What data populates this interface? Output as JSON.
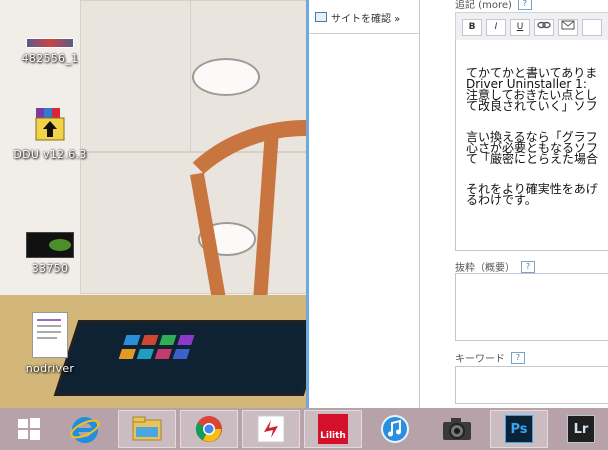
{
  "desktop": {
    "icons": [
      {
        "label": "482556_1",
        "icon": "image-thumbnail-icon"
      },
      {
        "label": "DDU v12.6.3",
        "icon": "winrar-archive-icon"
      },
      {
        "label": "33750",
        "icon": "gpu-image-icon"
      },
      {
        "label": "nodriver",
        "icon": "text-document-icon"
      }
    ]
  },
  "browser": {
    "sidebar_link": "サイトを確認 »",
    "main_header": "追記 (more)",
    "help_mark": "?",
    "editor_toolbar": [
      "B",
      "I",
      "U",
      "link",
      "mail",
      "more"
    ],
    "editor_lines": [
      "てかてかと書いてありま",
      "Driver Uninstaller 1:",
      "注意しておきたい点とし",
      "て改良されていく」ソフ"
    ],
    "editor_lines_2": [
      "言い換えるなら「グラフ",
      "心さが必要ともなるソフ",
      "て「厳密にとらえた場合"
    ],
    "editor_lines_3": [
      "それをより確実性をあげ",
      "るわけです。"
    ],
    "excerpt_label": "抜粋（概要）",
    "keyword_label": "キーワード"
  },
  "taskbar": {
    "items": [
      {
        "icon": "windows-start-icon"
      },
      {
        "icon": "internet-explorer-icon"
      },
      {
        "icon": "file-explorer-icon"
      },
      {
        "icon": "chrome-icon"
      },
      {
        "icon": "app-red-icon"
      },
      {
        "icon": "lilith-app-icon",
        "label": "Lilith"
      },
      {
        "icon": "itunes-icon"
      },
      {
        "icon": "camera-app-icon"
      },
      {
        "icon": "photoshop-icon",
        "label": "Ps"
      },
      {
        "icon": "lightroom-icon",
        "label": "Lr"
      }
    ]
  },
  "colors": {
    "taskbar": "#b7a2aa",
    "window_border": "#6fa8dc",
    "desktop_wood": "#c9753f"
  }
}
